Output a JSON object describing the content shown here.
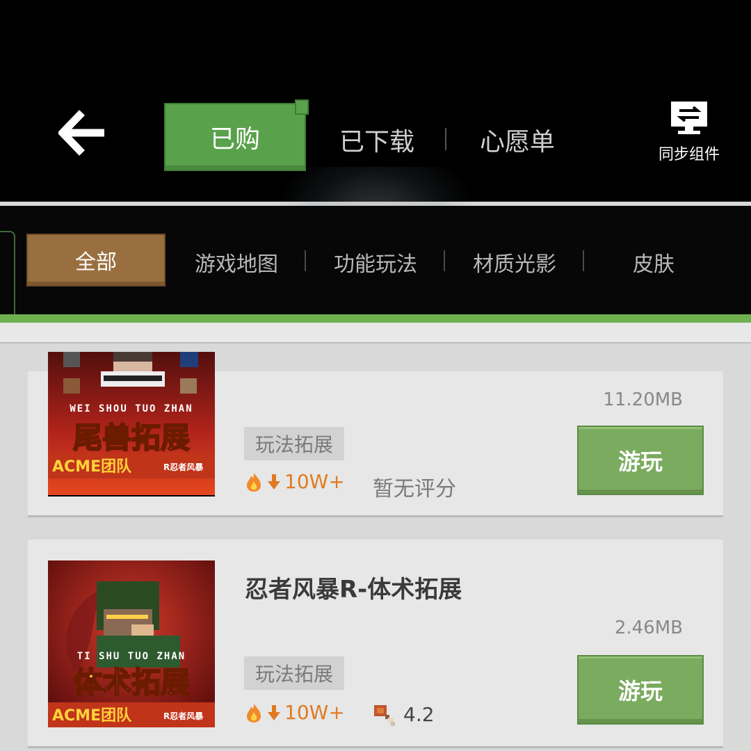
{
  "header": {
    "tabs": [
      {
        "label": "已购",
        "active": true
      },
      {
        "label": "已下载",
        "active": false
      },
      {
        "label": "心愿单",
        "active": false
      }
    ],
    "sync_label": "同步组件"
  },
  "categories": [
    "全部",
    "游戏地图",
    "功能玩法",
    "材质光影",
    "皮肤"
  ],
  "items": [
    {
      "title": "",
      "size": "11.20MB",
      "tag": "玩法拓展",
      "downloads": "10W+",
      "rating_text": "暂无评分",
      "play_label": "游玩",
      "thumb": {
        "subtitle": "WEI SHOU TUO ZHAN",
        "big": "尾兽拓展",
        "team": "ACME团队",
        "badge": "R忍者风暴"
      }
    },
    {
      "title": "忍者风暴R-体术拓展",
      "size": "2.46MB",
      "tag": "玩法拓展",
      "downloads": "10W+",
      "rating": "4.2",
      "play_label": "游玩",
      "thumb": {
        "subtitle": "TI SHU TUO ZHAN",
        "big": "体术拓展",
        "team": "ACME团队",
        "badge": "R忍者风暴"
      }
    }
  ],
  "colors": {
    "accent_green": "#5aa14c",
    "download_orange": "#e07a22",
    "category_brown": "#9a6f3f"
  }
}
